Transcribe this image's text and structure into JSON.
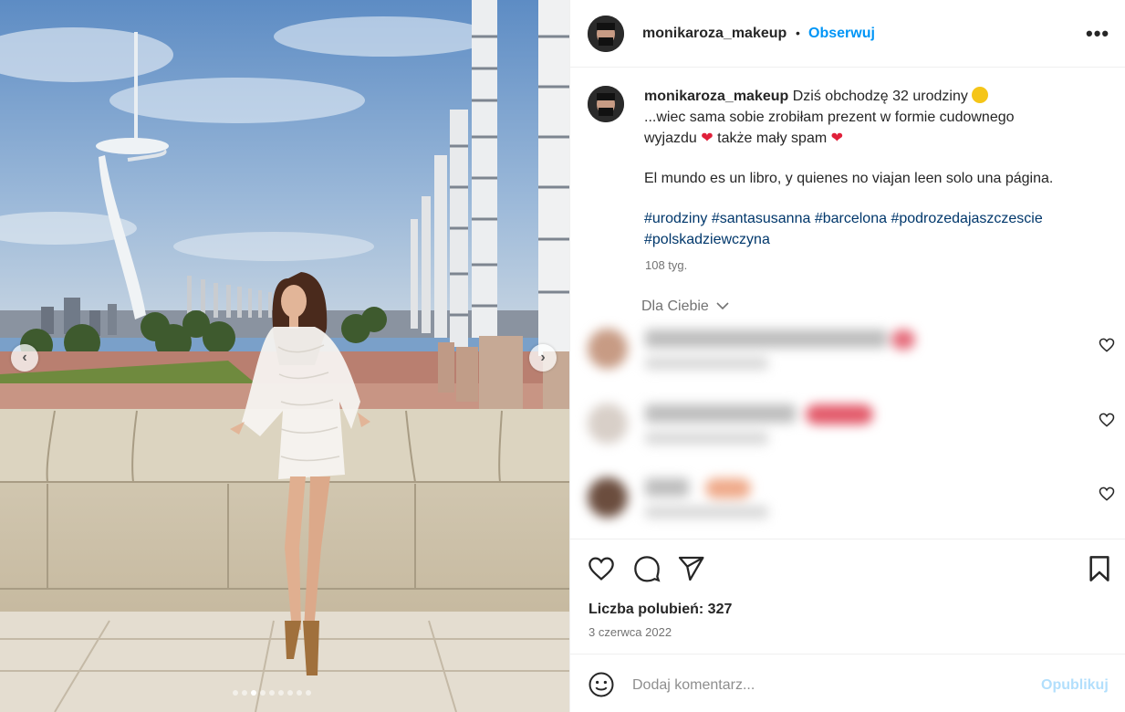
{
  "post": {
    "username": "monikaroza_makeup",
    "separator": "•",
    "follow_label": "Obserwuj",
    "more_icon": "more-horizontal-icon",
    "caption_lines": [
      "Dziś obchodzę 32 urodziny",
      "...wiec sama sobie zrobiłam prezent w formie cudownego",
      "wyjazdu",
      "także mały spam",
      "El mundo es un libro, y quienes no viajan leen solo una página."
    ],
    "hashtags": [
      "#urodziny",
      "#santasusanna",
      "#barcelona",
      "#podrozedajaszczescie",
      "#polskadziewczyna"
    ],
    "caption_time": "108 tyg.",
    "for_you_label": "Dla Ciebie",
    "likes_text": "Liczba polubień: 327",
    "date": "3 czerwca 2022",
    "add_comment_placeholder": "Dodaj komentarz...",
    "publish_label": "Opublikuj"
  },
  "photo": {
    "carousel_dot_count": 9,
    "active_dot": 2
  },
  "colors": {
    "link_blue": "#0095f6",
    "hashtag_blue": "#00376b",
    "publish_disabled": "#b2dffc",
    "heart_red": "#e0203a"
  }
}
